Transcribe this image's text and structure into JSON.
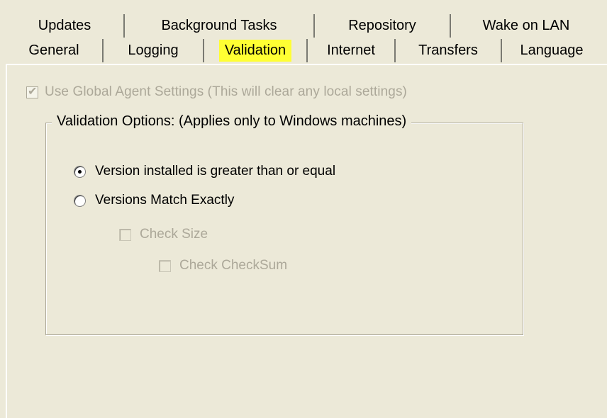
{
  "tabs": {
    "row_back": [
      {
        "label": "Updates"
      },
      {
        "label": "Background Tasks"
      },
      {
        "label": "Repository"
      },
      {
        "label": "Wake on LAN"
      }
    ],
    "row_front": [
      {
        "label": "General"
      },
      {
        "label": "Logging"
      },
      {
        "label": "Validation",
        "selected": true
      },
      {
        "label": "Internet"
      },
      {
        "label": "Transfers"
      },
      {
        "label": "Language"
      }
    ]
  },
  "global_setting": {
    "label": "Use Global Agent Settings (This will clear any local settings)",
    "checked": true,
    "enabled": false
  },
  "validation_group": {
    "title": "Validation Options: (Applies only to Windows machines)",
    "radio_options": [
      {
        "label": "Version installed is greater than or equal",
        "selected": true
      },
      {
        "label": "Versions Match Exactly",
        "selected": false
      }
    ],
    "check_size": {
      "label": "Check Size",
      "checked": false,
      "enabled": false
    },
    "check_checksum": {
      "label": "Check CheckSum",
      "checked": false,
      "enabled": false
    }
  },
  "colors": {
    "dialog_bg": "#ece9d8",
    "disabled_text": "#aca899",
    "highlight": "#ffff33"
  }
}
